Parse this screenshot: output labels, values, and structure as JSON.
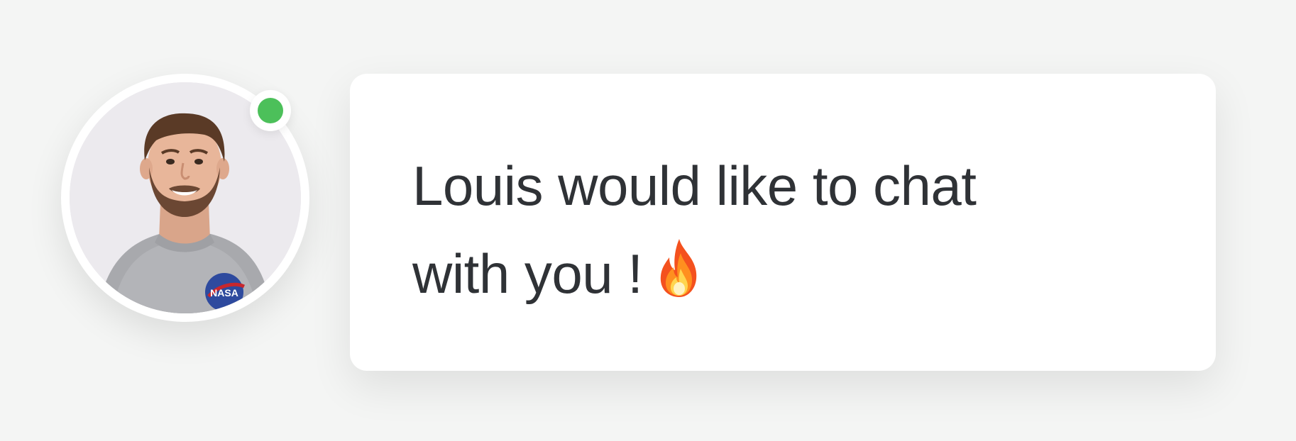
{
  "user": {
    "first_name": "Louis",
    "avatar_icon": "profile-photo",
    "status": "online",
    "status_color": "#4cc05a",
    "shirt_logo_text": "NASA"
  },
  "message": {
    "line1": "Louis would like to chat",
    "line2": "with you !",
    "emoji_icon": "fire-icon"
  },
  "colors": {
    "background": "#f4f5f4",
    "card": "#ffffff",
    "text": "#2f3236"
  }
}
